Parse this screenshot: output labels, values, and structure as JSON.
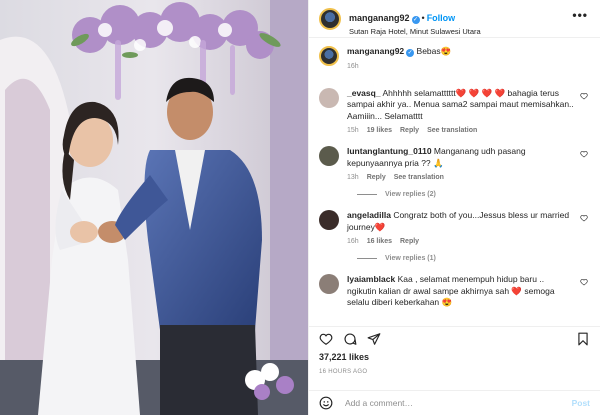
{
  "header": {
    "username": "manganang92",
    "follow_label": "Follow",
    "location": "Sutan Raja Hotel, Minut Sulawesi Utara",
    "more_label": "•••"
  },
  "caption": {
    "username": "manganang92",
    "text": "Bebas",
    "emoji": "😍",
    "time": "16h"
  },
  "comments": [
    {
      "username": "_evasq_",
      "text_parts": [
        "Ahhhhh selamatttttt",
        "❤️ ❤️ ❤️ ❤️",
        " bahagia terus sampai akhir ya.. Menua sama2 sampai maut memisahkan.. Aamiiin... Selamatttt"
      ],
      "time": "15h",
      "likes": "19 likes",
      "reply": "Reply",
      "translate": "See translation",
      "avatar_color": "#c9b8b2"
    },
    {
      "username": "luntanglantung_0110",
      "text_parts": [
        "Manganang udh pasang kepunyaannya pria ??",
        " 🙏",
        ""
      ],
      "time": "13h",
      "likes": "",
      "reply": "Reply",
      "translate": "See translation",
      "avatar_color": "#5b5b4c",
      "view_replies": "View replies (2)"
    },
    {
      "username": "angeladilla",
      "text_parts": [
        "Congratz both of you...Jessus bless ur married journey",
        "❤️",
        ""
      ],
      "time": "16h",
      "likes": "16 likes",
      "reply": "Reply",
      "translate": "",
      "avatar_color": "#3b2d2a",
      "view_replies": "View replies (1)"
    },
    {
      "username": "lyaiamblack",
      "text_parts": [
        "Kaa , selamat menempuh hidup baru .. ngikutin kalian dr awal sampe akhirnya sah",
        " ❤️",
        " semoga selalu diberi keberkahan 😍"
      ],
      "time": "",
      "likes": "",
      "reply": "",
      "translate": "",
      "avatar_color": "#8b7e77"
    }
  ],
  "actions": {
    "like_icon": "heart-icon",
    "comment_icon": "comment-icon",
    "share_icon": "share-icon",
    "save_icon": "bookmark-icon"
  },
  "likes_count": "37,221 likes",
  "posted_time": "16 HOURS AGO",
  "add_comment": {
    "placeholder": "Add a comment…",
    "post_label": "Post"
  },
  "colors": {
    "accent": "#0095f6",
    "verified": "#3897f0",
    "muted": "#8e8e8e"
  }
}
